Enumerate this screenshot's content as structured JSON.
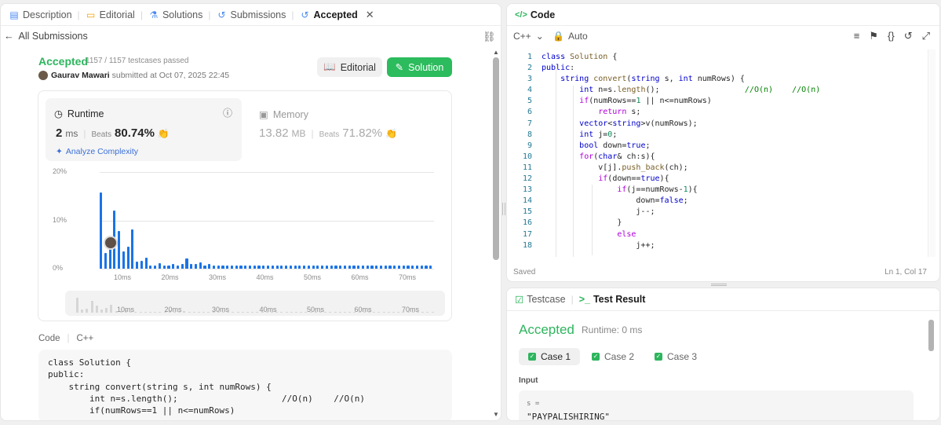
{
  "left_tabs": [
    {
      "label": "Description",
      "icon": "description-icon"
    },
    {
      "label": "Editorial",
      "icon": "editorial-icon"
    },
    {
      "label": "Solutions",
      "icon": "flask-icon"
    },
    {
      "label": "Submissions",
      "icon": "history-icon"
    },
    {
      "label": "Accepted",
      "icon": "clock-icon"
    }
  ],
  "back_label": "All Submissions",
  "result": {
    "status": "Accepted",
    "testcases": "1157 / 1157 testcases passed",
    "user": "Gaurav Mawari",
    "submitted": "submitted at Oct 07, 2025 22:45"
  },
  "buttons": {
    "editorial": "Editorial",
    "solution": "Solution"
  },
  "runtime": {
    "title": "Runtime",
    "value": "2",
    "unit": "ms",
    "beats_label": "Beats",
    "beats": "80.74%",
    "analyze": "Analyze Complexity"
  },
  "memory": {
    "title": "Memory",
    "value": "13.82",
    "unit": "MB",
    "beats_label": "Beats",
    "beats": "71.82%"
  },
  "chart_data": {
    "type": "bar",
    "y_ticks": [
      "20%",
      "10%",
      "0%"
    ],
    "x_ticks": [
      "10ms",
      "20ms",
      "30ms",
      "40ms",
      "50ms",
      "60ms",
      "70ms"
    ],
    "ylim": [
      0,
      20
    ],
    "values": [
      15.8,
      3.3,
      4.2,
      12.1,
      7.8,
      3.6,
      4.6,
      8.1,
      1.5,
      1.6,
      2.3,
      0.6,
      0.6,
      1.1,
      0.6,
      0.6,
      0.9,
      0.6,
      1.0,
      2.1,
      1.0,
      0.9,
      1.3,
      0.6,
      0.9,
      0.6,
      0.6,
      0.6,
      0.6,
      0.6,
      0.6,
      0.6,
      0.6,
      0.6,
      0.6,
      0.6,
      0.6,
      0.6,
      0.6,
      0.6,
      0.6,
      0.6,
      0.6,
      0.6,
      0.6,
      0.6,
      0.6,
      0.6,
      0.6,
      0.6,
      0.6,
      0.6,
      0.6,
      0.6,
      0.6,
      0.6,
      0.6,
      0.6,
      0.6,
      0.6,
      0.6,
      0.6,
      0.6,
      0.6,
      0.6,
      0.6,
      0.6,
      0.6,
      0.6,
      0.6,
      0.6,
      0.6,
      0.6,
      0.6
    ],
    "highlight_index": 3,
    "bar_color": "#1a73e8"
  },
  "code_section": {
    "label": "Code",
    "lang": "C++"
  },
  "preview_code": [
    "class Solution {",
    "public:",
    "    string convert(string s, int numRows) {",
    "        int n=s.length();                    //O(n)    //O(n)",
    "        if(numRows==1 || n<=numRows)"
  ],
  "editor": {
    "title": "Code",
    "lang": "C++",
    "mode": "Auto",
    "saved": "Saved",
    "position": "Ln 1, Col 17",
    "lines": [
      "class Solution {",
      "public:",
      "    string convert(string s, int numRows) {",
      "        int n=s.length();                  //O(n)    //O(n)",
      "        if(numRows==1 || n<=numRows)",
      "            return s;",
      "        vector<string>v(numRows);",
      "        int j=0;",
      "        bool down=true;",
      "        for(char& ch:s){",
      "            v[j].push_back(ch);",
      "            if(down==true){",
      "                if(j==numRows-1){",
      "                    down=false;",
      "                    j--;",
      "                }",
      "                else",
      "                    j++;"
    ],
    "line_numbers": [
      "1",
      "2",
      "3",
      "4",
      "5",
      "6",
      "7",
      "8",
      "9",
      "10",
      "11",
      "12",
      "13",
      "14",
      "15",
      "16",
      "17",
      "18"
    ]
  },
  "test_tabs": {
    "testcase": "Testcase",
    "result": "Test Result"
  },
  "test_result": {
    "status": "Accepted",
    "runtime": "Runtime: 0 ms",
    "cases": [
      "Case 1",
      "Case 2",
      "Case 3"
    ],
    "input_label": "Input",
    "var": "s =",
    "value": "\"PAYPALISHIRING\""
  },
  "colors": {
    "accepted": "#2db55d",
    "brand_green": "#2cbb5d",
    "tab_active": "#1a1a1a"
  }
}
